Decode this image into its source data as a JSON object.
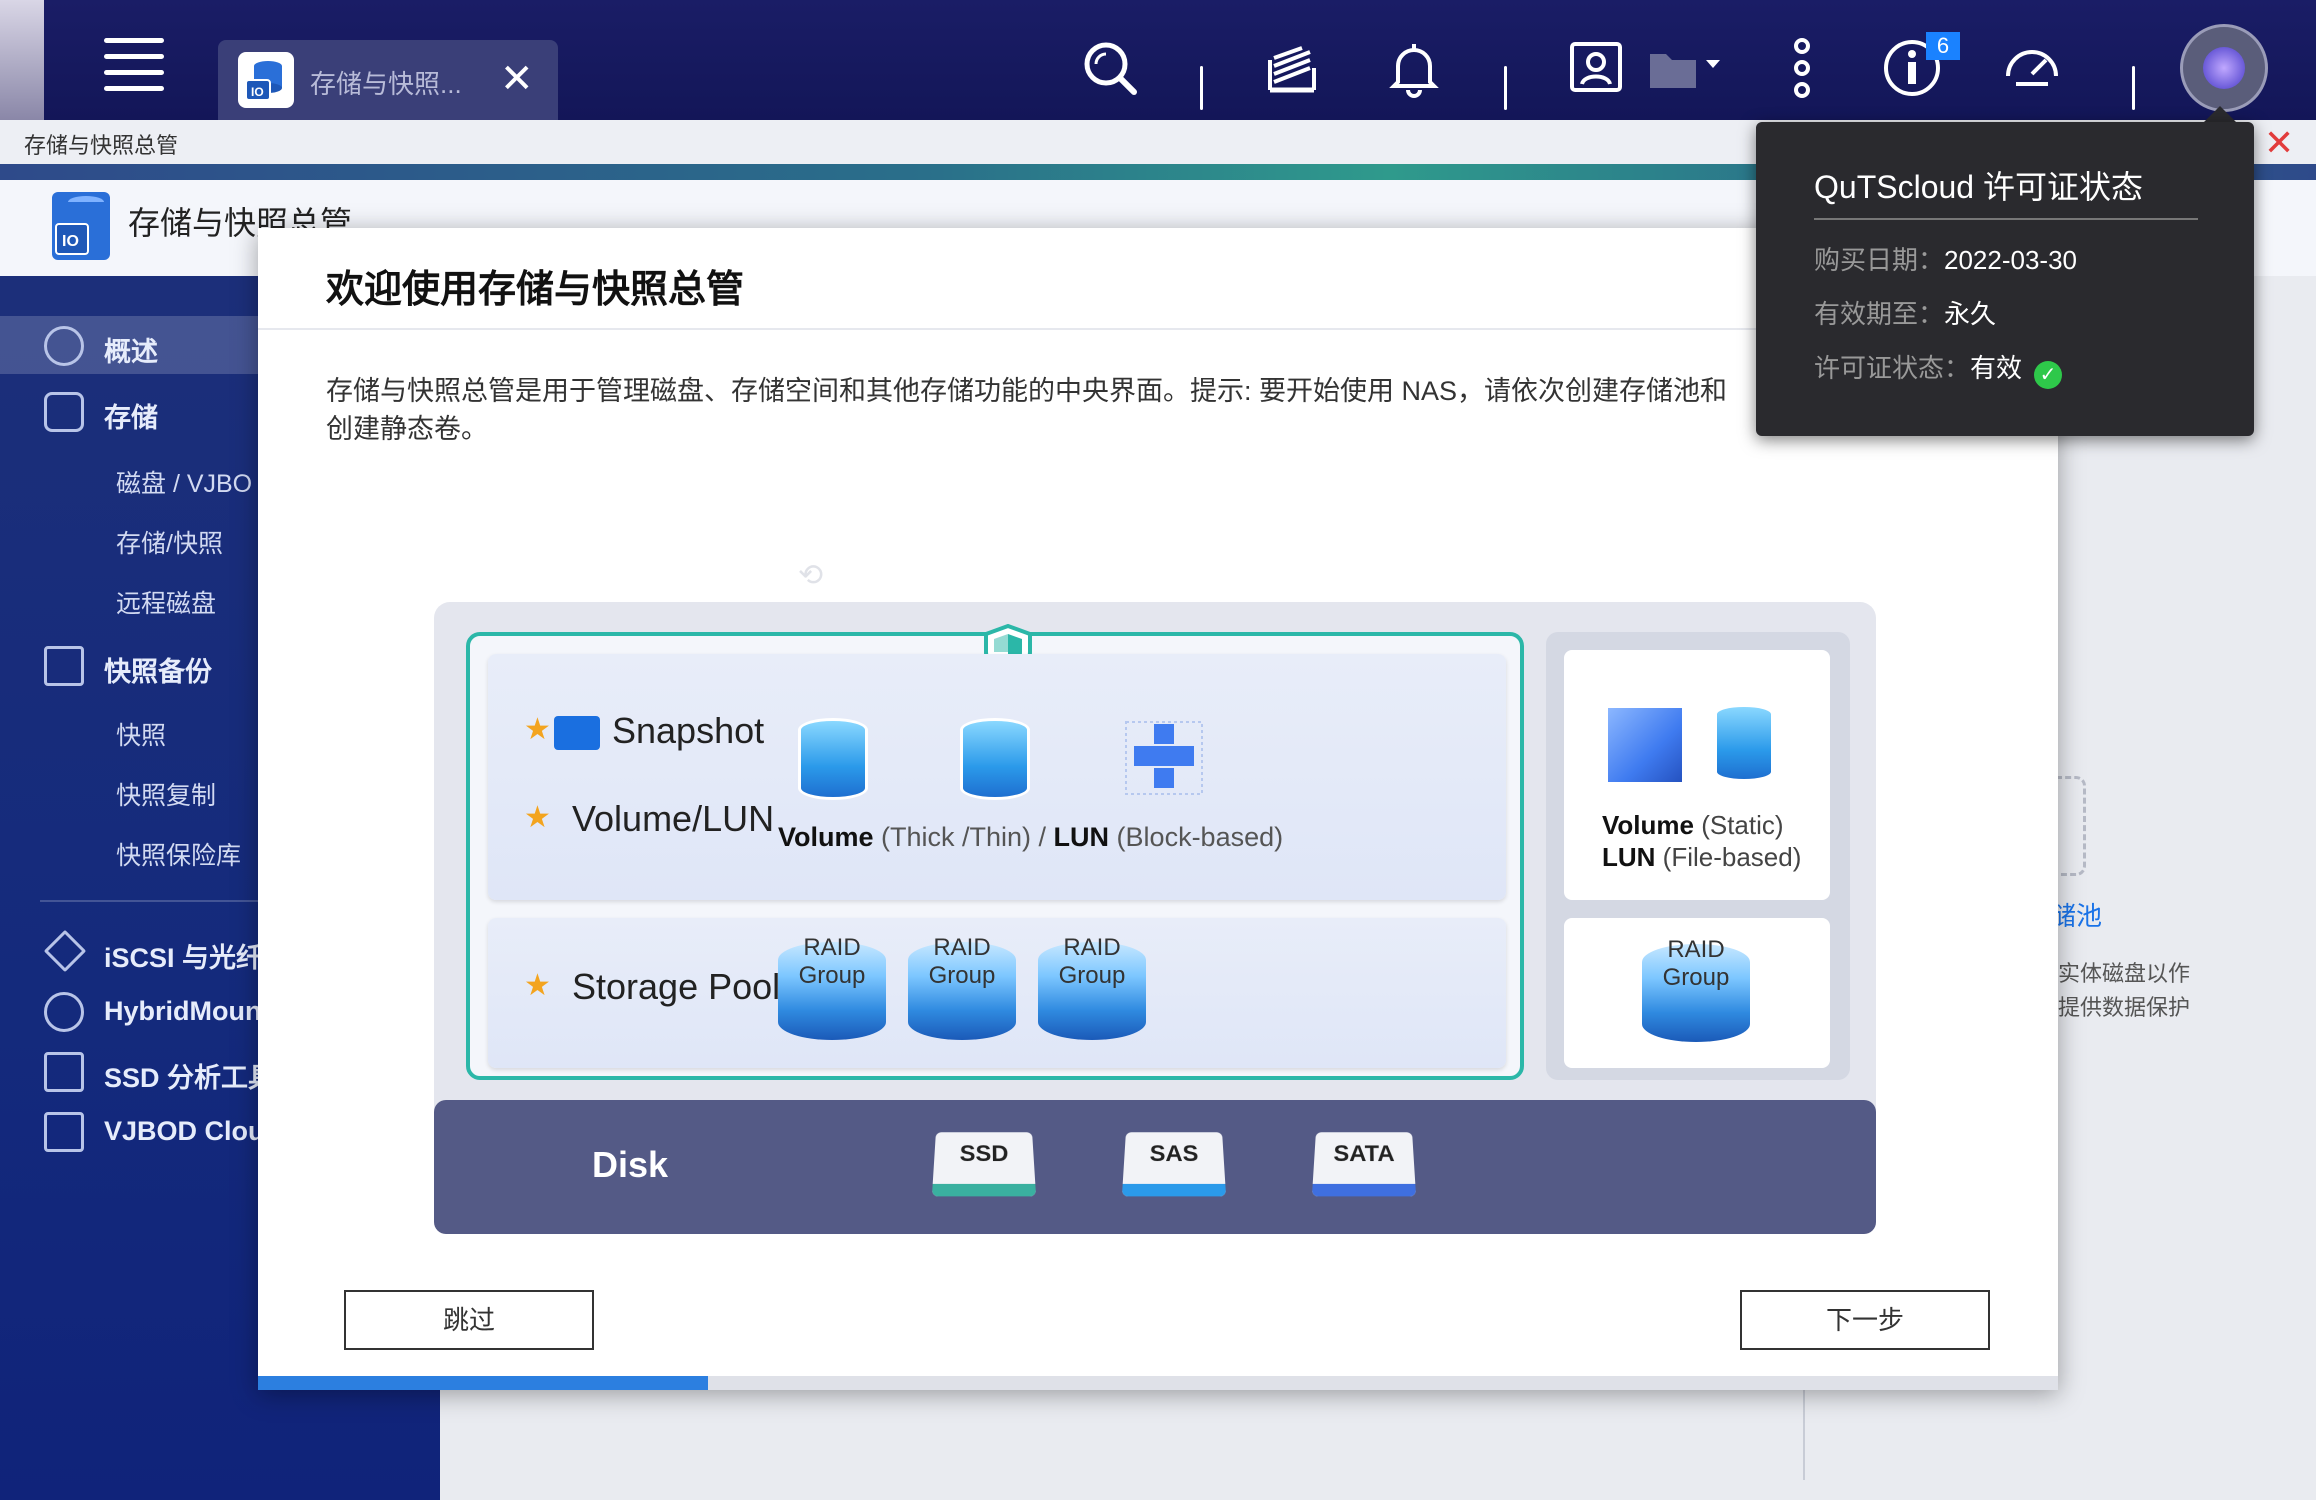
{
  "topbar": {
    "tab_label": "存储与快照...",
    "tab_close": "✕",
    "notification_badge": "6",
    "icons": [
      "menu-icon",
      "search-icon",
      "task-icon",
      "bell-icon",
      "user-card-icon",
      "folder-icon",
      "more-icon",
      "info-icon",
      "dashboard-icon",
      "avatar-icon"
    ]
  },
  "window": {
    "title": "存储与快照总管",
    "close": "✕"
  },
  "app_header": {
    "title": "存储与快照总管"
  },
  "sidebar": {
    "sections": [
      {
        "label": "概述",
        "icon": "dashboard-icon",
        "active": true
      },
      {
        "label": "存储",
        "icon": "database-icon",
        "children": [
          "磁盘 / VJBO",
          "存储/快照",
          "远程磁盘"
        ]
      },
      {
        "label": "快照备份",
        "icon": "snapshot-icon",
        "children": [
          "快照",
          "快照复制",
          "快照保险库"
        ]
      }
    ],
    "apps": [
      {
        "label": "iSCSI 与光纤",
        "icon": "iscsi-icon"
      },
      {
        "label": "HybridMoun",
        "icon": "cloud-icon"
      },
      {
        "label": "SSD 分析工具",
        "icon": "ssd-icon"
      },
      {
        "label": "VJBOD Clou",
        "icon": "vjbod-icon"
      }
    ]
  },
  "right_panel": {
    "title": "储池",
    "desc_lines": [
      "实体磁盘以作",
      "提供数据保护"
    ]
  },
  "modal": {
    "title": "欢迎使用存储与快照总管",
    "description_line1": "存储与快照总管是用于管理磁盘、存储空间和其他存储功能的中央界面。提示: 要开始使用 NAS，请依次创建存储池和",
    "description_line2": "创建静态卷。",
    "diagram": {
      "snapshot_label": "Snapshot",
      "volume_lun_label": "Volume/LUN",
      "storage_pool_label": "Storage Pool",
      "volume_caption_bold1": "Volume",
      "volume_caption_rest1": " (Thick /Thin)  / ",
      "volume_caption_bold2": "LUN",
      "volume_caption_rest2": " (Block-based)",
      "raid_line1": "RAID",
      "raid_line2": "Group",
      "side_static_bold": "Volume",
      "side_static_rest": " (Static)",
      "side_lun_bold": "LUN",
      "side_lun_rest": " (File-based)",
      "disk_label": "Disk",
      "disk_types": [
        {
          "label": "SSD",
          "color": "#3ab0a0"
        },
        {
          "label": "SAS",
          "color": "#2b9aea"
        },
        {
          "label": "SATA",
          "color": "#3f6fe0"
        }
      ]
    },
    "skip_button": "跳过",
    "next_button": "下一步",
    "progress_fraction": 0.25
  },
  "license": {
    "title": "QuTScloud 许可证状态",
    "purchase_key": "购买日期：",
    "purchase_value": "2022-03-30",
    "expiry_key": "有效期至：",
    "expiry_value": "永久",
    "status_key": "许可证状态：",
    "status_value": "有效",
    "status_icon": "check-circle-icon"
  },
  "colors": {
    "accent": "#2c7fe0",
    "teal_frame": "#2bb7a8",
    "close_red": "#e23c3c",
    "star": "#f3a41f",
    "check_green": "#2ec84a"
  }
}
